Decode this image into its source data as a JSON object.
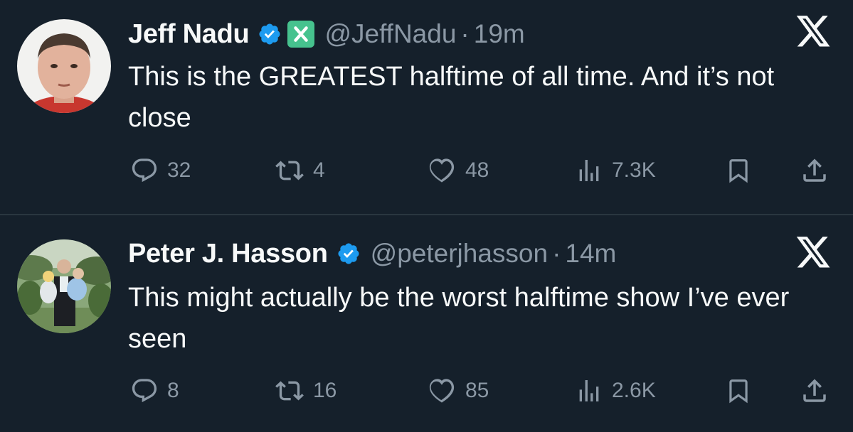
{
  "tweets": [
    {
      "display_name": "Jeff Nadu",
      "handle": "@JeffNadu",
      "separator": "·",
      "time": "19m",
      "text": "This is the GREATEST halftime of all time. And it’s not close",
      "replies": "32",
      "reposts": "4",
      "likes": "48",
      "views": "7.3K",
      "verified_icon": "verified-badge-icon",
      "affiliation_icon": "x-affiliate-badge-icon"
    },
    {
      "display_name": "Peter J. Hasson",
      "handle": "@peterjhasson",
      "separator": "·",
      "time": "14m",
      "text": "This might actually be the worst halftime show I’ve ever seen",
      "replies": "8",
      "reposts": "16",
      "likes": "85",
      "views": "2.6K",
      "verified_icon": "verified-badge-icon"
    }
  ],
  "icons": {
    "reply": "reply-icon",
    "repost": "repost-icon",
    "like": "like-icon",
    "views": "views-icon",
    "bookmark": "bookmark-icon",
    "share": "share-icon",
    "platform": "x-logo-icon"
  },
  "colors": {
    "background": "#15202b",
    "text": "#f7f9f9",
    "secondary_text": "#8b98a5",
    "verified": "#1d9bf0",
    "affiliate_badge": "#46c28e",
    "divider": "#2a3640"
  }
}
